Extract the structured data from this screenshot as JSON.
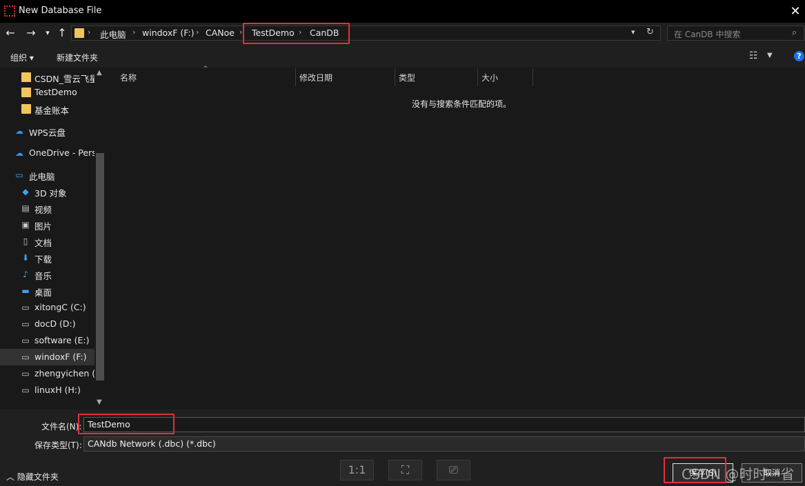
{
  "window": {
    "title": "New Database File",
    "close_glyph": "✕"
  },
  "nav": {
    "back": "←",
    "forward": "→",
    "recent": "▾",
    "up": "↑"
  },
  "address": {
    "crumbs": [
      "此电脑",
      "windoxF (F:)",
      "CANoe",
      "TestDemo",
      "CanDB"
    ],
    "separator": "›"
  },
  "search": {
    "placeholder": "在 CanDB 中搜索"
  },
  "toolbar": {
    "organize": "组织 ▾",
    "new_folder": "新建文件夹",
    "help": "?"
  },
  "sidebar": {
    "items": [
      {
        "label": "CSDN_雪云飞星",
        "icon": "folder-icon"
      },
      {
        "label": "TestDemo",
        "icon": "folder-icon"
      },
      {
        "label": "基金账本",
        "icon": "folder-icon"
      },
      {
        "label": "WPS云盘",
        "icon": "cloud-icon"
      },
      {
        "label": "OneDrive - Perso",
        "icon": "cloud-icon"
      },
      {
        "label": "此电脑",
        "icon": "computer-icon"
      },
      {
        "label": "3D 对象",
        "icon": "cube-icon"
      },
      {
        "label": "视频",
        "icon": "video-icon"
      },
      {
        "label": "图片",
        "icon": "picture-icon"
      },
      {
        "label": "文档",
        "icon": "document-icon"
      },
      {
        "label": "下载",
        "icon": "download-icon"
      },
      {
        "label": "音乐",
        "icon": "music-icon"
      },
      {
        "label": "桌面",
        "icon": "desktop-icon"
      },
      {
        "label": "xitongC (C:)",
        "icon": "drive-icon"
      },
      {
        "label": "docD (D:)",
        "icon": "drive-icon"
      },
      {
        "label": "software (E:)",
        "icon": "drive-icon"
      },
      {
        "label": "windoxF (F:)",
        "icon": "drive-icon"
      },
      {
        "label": "zhengyichen (G",
        "icon": "drive-icon"
      },
      {
        "label": "linuxH (H:)",
        "icon": "drive-icon"
      }
    ]
  },
  "filelist": {
    "columns": [
      "名称",
      "修改日期",
      "类型",
      "大小"
    ],
    "empty_message": "没有与搜索条件匹配的项。"
  },
  "form": {
    "filename_label": "文件名(N):",
    "filename_value": "TestDemo",
    "filetype_label": "保存类型(T):",
    "filetype_value": "CANdb Network (.dbc) (*.dbc)"
  },
  "footer": {
    "hide_folders": "隐藏文件夹",
    "save": "保存(S)",
    "cancel": "取消",
    "ctrl_actual_size": "1:1",
    "watermark": "CSDN @时时一省"
  },
  "colors": {
    "highlight": "#e0313b",
    "folder": "#f2c55c",
    "help": "#1a73e8"
  }
}
